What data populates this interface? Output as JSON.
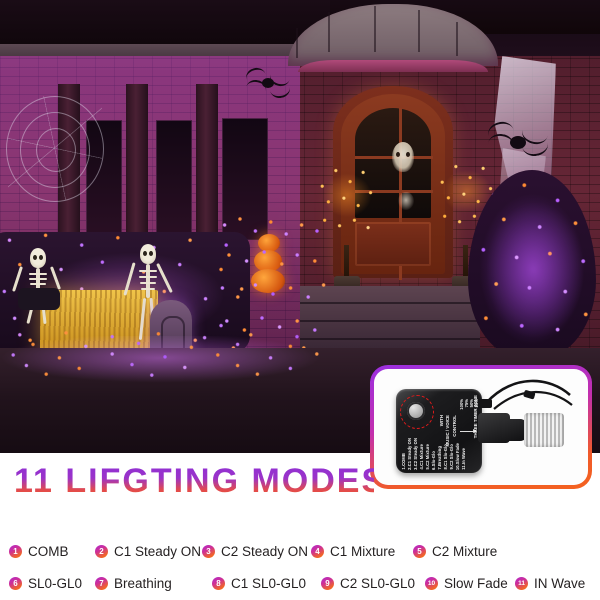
{
  "headline": {
    "text": "11 LIFGTING MODES",
    "gradient_top": "#8e2fd6",
    "gradient_bottom": "#f4541d"
  },
  "panel": {
    "background": "#ffffff",
    "text_color": "#231f20"
  },
  "badge_colors": {
    "start": "#b02ad0",
    "mid": "#cd2f97",
    "end": "#f4701c"
  },
  "modes": [
    {
      "num": "1",
      "label": "COMB"
    },
    {
      "num": "2",
      "label": "C1 Steady ON"
    },
    {
      "num": "3",
      "label": "C2 Steady ON"
    },
    {
      "num": "4",
      "label": "C1 Mixture"
    },
    {
      "num": "5",
      "label": "C2 Mixture"
    },
    {
      "num": "6",
      "label": "SL0-GL0"
    },
    {
      "num": "7",
      "label": "Breathing"
    },
    {
      "num": "8",
      "label": "C1 SL0-GL0"
    },
    {
      "num": "9",
      "label": "C2 SL0-GL0"
    },
    {
      "num": "10",
      "label": "Slow Fade"
    },
    {
      "num": "11",
      "label": "IN Wave"
    }
  ],
  "inset": {
    "border_gradient_start": "#9b2fe0",
    "border_gradient_end": "#f4621f",
    "device": {
      "button_ring_color": "#e01b1b",
      "mode_list_text": "1.COMB 2.C1 Steady ON 3.C2 Steady ON 4.C1 Mixture 5.C2 Mixture 6.Slo-Glo 7.Breathing 8.C1 Slo-Glo 9.C2 Slo-Glo 10.Slow Fade 11.In Wave",
      "mode_lines": [
        "1.COMB",
        "2.C1 Steady ON",
        "3.C2 Steady ON",
        "4.C1 Mixture",
        "5.C2 Mixture",
        "6.Slo-Glo",
        "7.Breathing",
        "8.C1 Slo-Glo",
        "9.C2 Slo-Glo",
        "10.Slow Fade",
        "11.In Wave"
      ],
      "music_label_lines": [
        "WITH",
        "MUSIC / VOICE",
        "CONTROL"
      ],
      "brightness_levels": [
        "100%",
        "75%",
        "50%",
        "25%"
      ],
      "timer_label": "THREE TIMER ZONE"
    }
  },
  "photo": {
    "description": "Halloween-decorated house front at night with purple and orange string lights",
    "scene_elements": [
      "arched double front door",
      "two orange lit trees",
      "purple lit tree",
      "two posed skeletons",
      "hay bale",
      "tombstone",
      "giant black spiders",
      "white gauze drape",
      "stacked pumpkins",
      "brick facade",
      "stone steps"
    ]
  }
}
